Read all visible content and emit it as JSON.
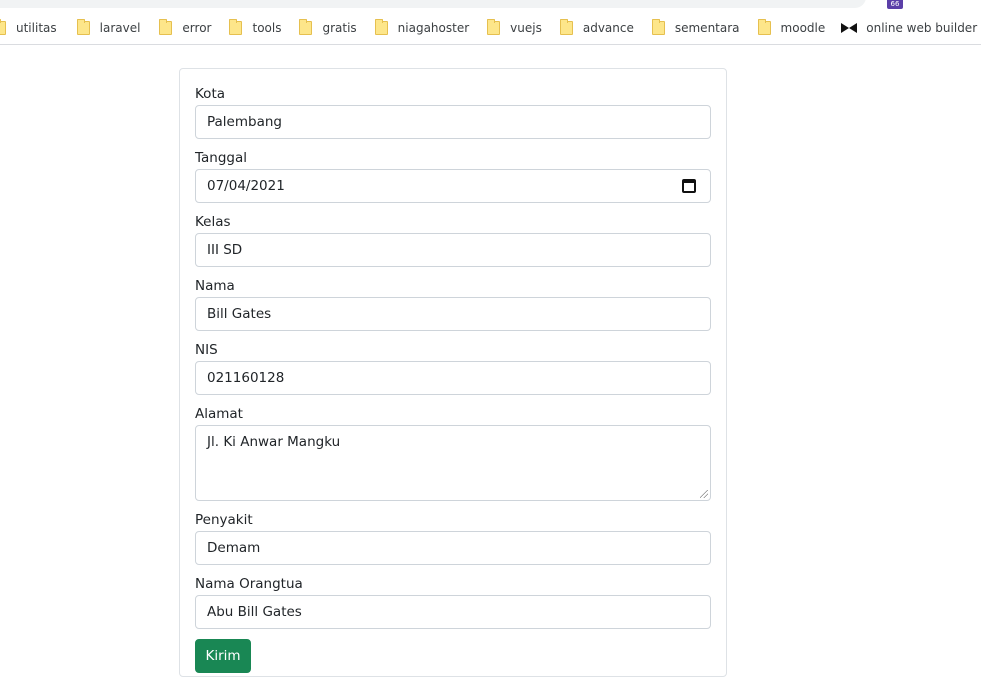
{
  "bookmarks": [
    {
      "label": "utilitas",
      "icon": "folder-icon"
    },
    {
      "label": "laravel",
      "icon": "folder-icon"
    },
    {
      "label": "error",
      "icon": "folder-icon"
    },
    {
      "label": "tools",
      "icon": "folder-icon"
    },
    {
      "label": "gratis",
      "icon": "folder-icon"
    },
    {
      "label": "niagahoster",
      "icon": "folder-icon"
    },
    {
      "label": "vuejs",
      "icon": "folder-icon"
    },
    {
      "label": "advance",
      "icon": "folder-icon"
    },
    {
      "label": "sementara",
      "icon": "folder-icon"
    },
    {
      "label": "moodle",
      "icon": "folder-icon"
    },
    {
      "label": "online web builder",
      "icon": "bowtie-icon"
    }
  ],
  "extension_badge": "66",
  "form": {
    "fields": {
      "kota": {
        "label": "Kota",
        "value": "Palembang"
      },
      "tanggal": {
        "label": "Tanggal",
        "value": "07/04/2021"
      },
      "kelas": {
        "label": "Kelas",
        "value": "III SD"
      },
      "nama": {
        "label": "Nama",
        "value": "Bill Gates"
      },
      "nis": {
        "label": "NIS",
        "value": "021160128"
      },
      "alamat": {
        "label": "Alamat",
        "value": "Jl. Ki Anwar Mangku"
      },
      "penyakit": {
        "label": "Penyakit",
        "value": "Demam"
      },
      "nama_orangtua": {
        "label": "Nama Orangtua",
        "value": "Abu Bill Gates"
      }
    },
    "submit_label": "Kirim"
  },
  "colors": {
    "button": "#198754",
    "border": "#ced4da",
    "text": "#212529"
  }
}
